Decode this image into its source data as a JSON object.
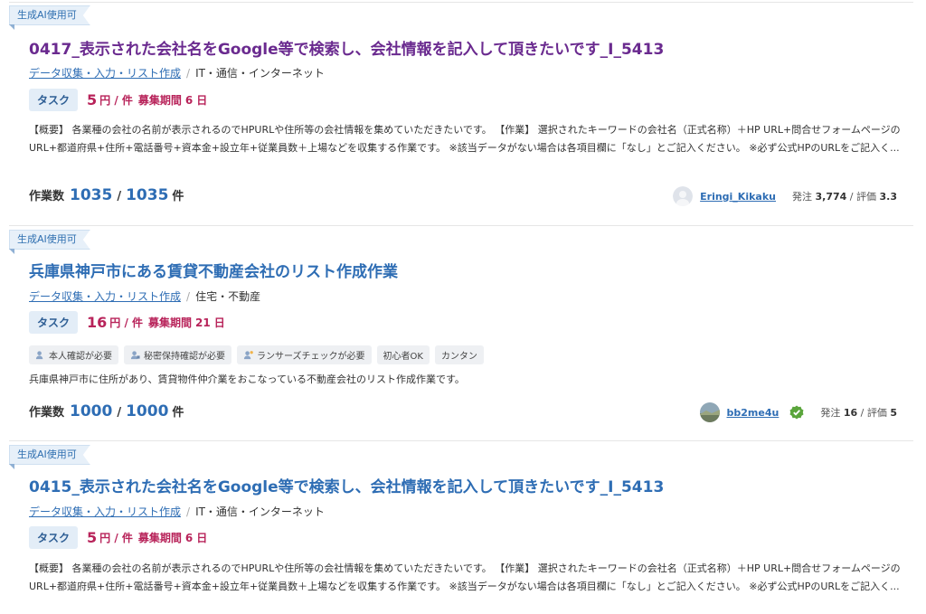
{
  "jobs": [
    {
      "badge": "生成AI使用可",
      "title": "0417_表示された会社名をGoogle等で検索し、会社情報を記入して頂きたいです_I_5413",
      "category": "データ収集・入力・リスト作成",
      "subcategory": "IT・通信・インターネット",
      "task_label": "タスク",
      "price": "5",
      "price_unit": "円 / 件",
      "period_label": "募集期間",
      "period": "6",
      "period_unit": "日",
      "description": "【概要】 各業種の会社の名前が表示されるのでHPURLや住所等の会社情報を集めていただきたいです。 【作業】 選択されたキーワードの会社名（正式名称）＋HP URL+問合せフォームページのURL+都道府県+住所+電話番号+資本金+設立年+従業員数＋上場などを収集する作業です。 ※該当データがない場合は各項目欄に「なし」とご記入ください。 ※必ず公式HPのURLをご記入く...",
      "count_label": "作業数",
      "count_done": "1035",
      "count_total": "1035",
      "count_unit": "件",
      "client_name": "Eringi_Kikaku",
      "orders_label": "発注",
      "orders": "3,774",
      "rating_label": "評価",
      "rating": "3.3"
    },
    {
      "badge": "生成AI使用可",
      "title": "兵庫県神戸市にある賃貸不動産会社のリスト作成作業",
      "category": "データ収集・入力・リスト作成",
      "subcategory": "住宅・不動産",
      "task_label": "タスク",
      "price": "16",
      "price_unit": "円 / 件",
      "period_label": "募集期間",
      "period": "21",
      "period_unit": "日",
      "tags": [
        "本人確認が必要",
        "秘密保持確認が必要",
        "ランサーズチェックが必要",
        "初心者OK",
        "カンタン"
      ],
      "description": "兵庫県神戸市に住所があり、賃貸物件仲介業をおこなっている不動産会社のリスト作成作業です。",
      "count_label": "作業数",
      "count_done": "1000",
      "count_total": "1000",
      "count_unit": "件",
      "client_name": "bb2me4u",
      "orders_label": "発注",
      "orders": "16",
      "rating_label": "評価",
      "rating": "5"
    },
    {
      "badge": "生成AI使用可",
      "title": "0415_表示された会社名をGoogle等で検索し、会社情報を記入して頂きたいです_I_5413",
      "category": "データ収集・入力・リスト作成",
      "subcategory": "IT・通信・インターネット",
      "task_label": "タスク",
      "price": "5",
      "price_unit": "円 / 件",
      "period_label": "募集期間",
      "period": "6",
      "period_unit": "日",
      "description": "【概要】 各業種の会社の名前が表示されるのでHPURLや住所等の会社情報を集めていただきたいです。 【作業】 選択されたキーワードの会社名（正式名称）＋HP URL+問合せフォームページのURL+都道府県+住所+電話番号+資本金+設立年+従業員数＋上場などを収集する作業です。 ※該当データがない場合は各項目欄に「なし」とご記入ください。 ※必ず公式HPのURLをご記入く..."
    }
  ]
}
